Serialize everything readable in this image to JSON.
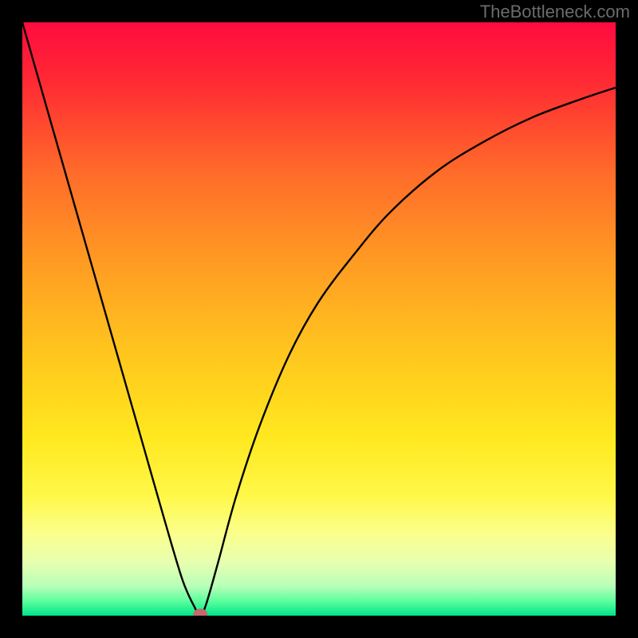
{
  "watermark": "TheBottleneck.com",
  "chart_data": {
    "type": "line",
    "title": "",
    "xlabel": "",
    "ylabel": "",
    "xlim": [
      0,
      100
    ],
    "ylim": [
      0,
      100
    ],
    "series": [
      {
        "name": "curve",
        "x": [
          0,
          4,
          8,
          12,
          16,
          20,
          24,
          27,
          29,
          30,
          31,
          33,
          36,
          40,
          45,
          50,
          56,
          62,
          70,
          78,
          86,
          94,
          100
        ],
        "values": [
          100,
          86,
          72,
          58,
          44,
          30,
          16,
          6,
          1.5,
          0,
          2,
          9,
          20,
          32,
          44,
          53,
          61,
          68,
          75,
          80,
          84,
          87,
          89
        ]
      }
    ],
    "marker": {
      "x": 30,
      "y": 0,
      "rx": 1.2,
      "ry": 0.9,
      "color": "#c36a6a"
    },
    "gradient_stops": [
      {
        "offset": 0.0,
        "color": "#ff0b3f"
      },
      {
        "offset": 0.1,
        "color": "#ff2a33"
      },
      {
        "offset": 0.25,
        "color": "#ff6a2a"
      },
      {
        "offset": 0.4,
        "color": "#ff9a23"
      },
      {
        "offset": 0.55,
        "color": "#ffc41e"
      },
      {
        "offset": 0.7,
        "color": "#ffe81f"
      },
      {
        "offset": 0.8,
        "color": "#fff84a"
      },
      {
        "offset": 0.86,
        "color": "#fbff8a"
      },
      {
        "offset": 0.91,
        "color": "#e7ffb0"
      },
      {
        "offset": 0.95,
        "color": "#b8ffb8"
      },
      {
        "offset": 0.975,
        "color": "#5eff9e"
      },
      {
        "offset": 1.0,
        "color": "#00e589"
      }
    ]
  },
  "colors": {
    "frame": "#000000",
    "curve": "#000000"
  }
}
